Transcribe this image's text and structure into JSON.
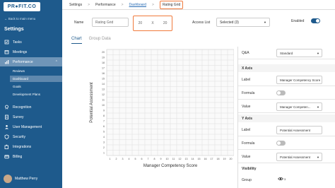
{
  "sidebar": {
    "logo": "PR●FIT.CO",
    "back_link": "← Back to main menu",
    "section_title": "Settings",
    "items": [
      {
        "label": "Tasks",
        "icon": "checklist-icon"
      },
      {
        "label": "Meetings",
        "icon": "calendar-icon"
      },
      {
        "label": "Performance",
        "icon": "chart-icon"
      },
      {
        "label": "Recognition",
        "icon": "award-icon"
      },
      {
        "label": "Survey",
        "icon": "survey-icon"
      },
      {
        "label": "User Management",
        "icon": "users-icon"
      },
      {
        "label": "Security",
        "icon": "shield-icon"
      },
      {
        "label": "Integrations",
        "icon": "puzzle-icon"
      },
      {
        "label": "Billing",
        "icon": "card-icon"
      }
    ],
    "subitems": [
      "Reviews",
      "Dashboard",
      "Goals",
      "Development Plans"
    ],
    "user_name": "Matthew Perry"
  },
  "breadcrumb": {
    "items": [
      "Settings",
      "Performance",
      "Dashboard"
    ],
    "current": "Rating Grid",
    "separator": ">"
  },
  "form": {
    "name_label": "Name",
    "name_value": "Rating Grid",
    "grid_x": "20",
    "grid_times": "X",
    "grid_y": "20",
    "access_label": "Access List",
    "access_value": "Selected (3)",
    "enabled_label": "Enabled"
  },
  "tabs": [
    "Chart",
    "Group Data"
  ],
  "chart": {
    "x_axis_label": "Manager Competency Score",
    "y_axis_label": "Potential Assessment",
    "x_ticks": [
      "1",
      "2",
      "3",
      "4",
      "5",
      "6",
      "7",
      "8",
      "9",
      "10",
      "11",
      "12",
      "13",
      "14",
      "15",
      "16",
      "17",
      "18",
      "19",
      "20"
    ],
    "y_ticks": [
      "1",
      "2",
      "3",
      "4",
      "5",
      "6",
      "7",
      "8",
      "9",
      "10",
      "11",
      "12",
      "13",
      "14",
      "15",
      "16",
      "17",
      "18",
      "19",
      "20"
    ]
  },
  "settings_panel": {
    "qa_label": "Q&A",
    "qa_value": "Standard",
    "x_axis_header": "X Axis",
    "x_label_label": "Label",
    "x_label_value": "Manager Competency Score",
    "x_formula_label": "Formula",
    "x_value_label": "Value",
    "x_value_value": "Manager Competen...",
    "y_axis_header": "Y Axis",
    "y_label_label": "Label",
    "y_label_value": "Potential Assessment",
    "y_formula_label": "Formula",
    "y_value_label": "Value",
    "y_value_value": "Potential Assessment",
    "visibility_header": "Visibility",
    "group_label": "Group",
    "group_count": "3"
  },
  "colors": {
    "sidebar": "#1e5a8c",
    "accent": "#2a6db5",
    "highlight": "#f07a3c"
  }
}
